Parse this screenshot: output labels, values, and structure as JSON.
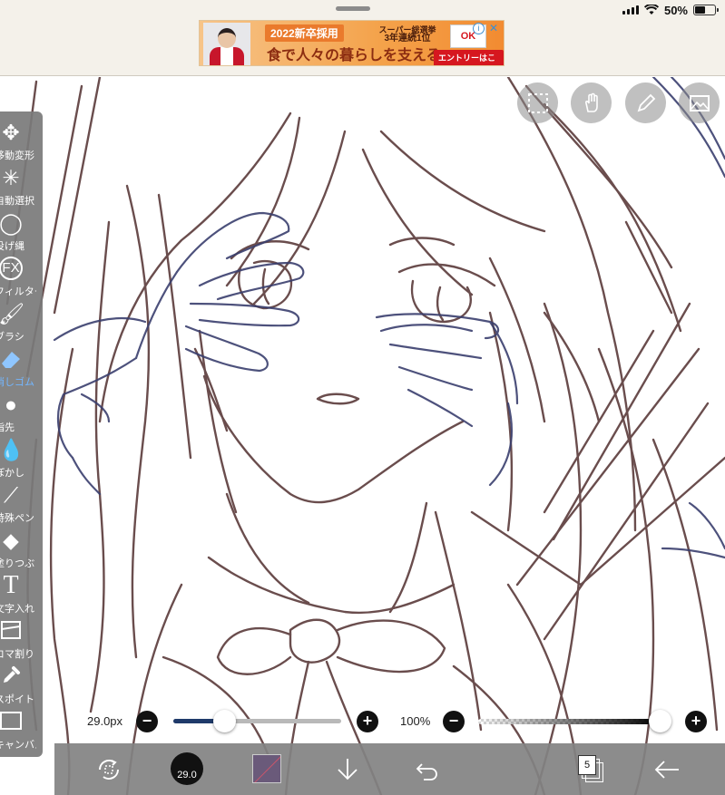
{
  "status_bar": {
    "battery": "50%",
    "battery_level": 0.5
  },
  "ad": {
    "year_tag": "2022新卒採用",
    "slogan": "食で人々の暮らしを支える",
    "badge_line1": "スーパー総選挙",
    "badge_line2": "3年連続1位",
    "cta": "エントリーはこちら",
    "info_icon": "info-icon",
    "close_icon": "close-icon"
  },
  "toolbar": {
    "items": [
      {
        "label": "移動変形",
        "icon": "move-icon"
      },
      {
        "label": "自動選択",
        "icon": "magic-wand-icon"
      },
      {
        "label": "投げ縄",
        "icon": "lasso-icon"
      },
      {
        "label": "フィルター",
        "icon": "fx-icon",
        "icon_text": "FX"
      },
      {
        "label": "ブラシ",
        "icon": "brush-icon"
      },
      {
        "label": "消しゴム",
        "icon": "eraser-icon",
        "active": true
      },
      {
        "label": "指先",
        "icon": "finger-icon"
      },
      {
        "label": "ぼかし",
        "icon": "blur-icon"
      },
      {
        "label": "特殊ペン",
        "icon": "special-pen-icon"
      },
      {
        "label": "塗りつぶし",
        "icon": "fill-icon"
      },
      {
        "label": "文字入れ",
        "icon": "text-icon",
        "icon_text": "T"
      },
      {
        "label": "コマ割り",
        "icon": "frame-divider-icon"
      },
      {
        "label": "スポイト",
        "icon": "eyedropper-icon"
      },
      {
        "label": "キャンバス",
        "icon": "canvas-icon"
      }
    ],
    "active_color": "#73b6ff"
  },
  "top_buttons": [
    "selection-icon",
    "hand-icon",
    "pen-icon",
    "image-icon"
  ],
  "brush": {
    "size_label": "29.0px",
    "size_value": "29.0",
    "size_fraction": 0.3
  },
  "opacity": {
    "label": "100%",
    "fraction": 1.0
  },
  "buttons": {
    "minus": "−",
    "plus": "+"
  },
  "bottom_bar": {
    "icons": [
      "transform-icon",
      "brush-preview",
      "color-swatch",
      "import-icon",
      "undo-icon",
      "layers-icon",
      "back-icon"
    ],
    "layer_count": "5",
    "color": "#6a5a7a"
  },
  "colors": {
    "line_brown": "#5a3a3a",
    "line_blue": "#3a3f6e"
  }
}
